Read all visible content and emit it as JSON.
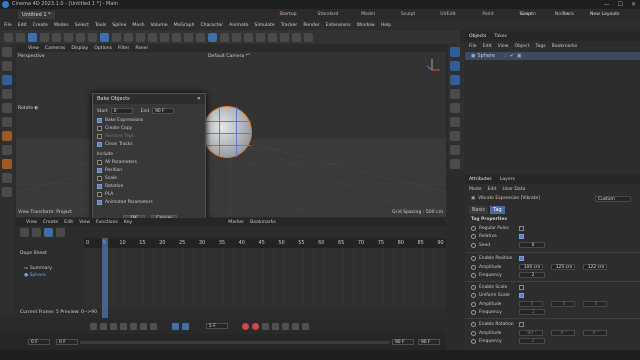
{
  "window": {
    "title": "Cinema 4D 2023.1.0 - [Untitled 1 *] - Main",
    "doc_tab": "Untitled 1 *",
    "controls": [
      "—",
      "☐",
      "✕"
    ]
  },
  "layout_tabs": [
    "Startup",
    "Standard",
    "Model",
    "Sculpt",
    "UVEdit",
    "Paint",
    "Groom",
    "Track",
    "Script",
    "Nodes"
  ],
  "new_layouts": "New Layouts",
  "menubar": [
    "File",
    "Edit",
    "Create",
    "Modes",
    "Select",
    "Tools",
    "Spline",
    "Mesh",
    "Volume",
    "MoGraph",
    "Character",
    "Animate",
    "Simulate",
    "Tracker",
    "Render",
    "Extensions",
    "Window",
    "Help"
  ],
  "viewport": {
    "menu": [
      "View",
      "Cameras",
      "Display",
      "Options",
      "Filter",
      "Panel"
    ],
    "name": "Perspective",
    "camera": "Default Camera *°",
    "rotate_label": "Rotate ◐",
    "transform_label": "View Transform: Project",
    "grid_label": "Grid Spacing : 500 cm"
  },
  "dialog": {
    "title": "Bake Objects",
    "start_label": "Start",
    "start_value": "0",
    "end_label": "End",
    "end_value": "90 F",
    "options": [
      {
        "label": "Bake Expressions",
        "checked": true,
        "dim": false
      },
      {
        "label": "Create Copy",
        "checked": false,
        "dim": false
      },
      {
        "label": "Remove Tags",
        "checked": false,
        "dim": true
      },
      {
        "label": "Clean Tracks",
        "checked": true,
        "dim": false
      }
    ],
    "include_label": "Include",
    "include": [
      {
        "label": "All Parameters",
        "checked": false
      },
      {
        "label": "Position",
        "checked": true
      },
      {
        "label": "Scale",
        "checked": false
      },
      {
        "label": "Rotation",
        "checked": true
      },
      {
        "label": "PLA",
        "checked": false
      },
      {
        "label": "Animated Parameters",
        "checked": true
      }
    ],
    "ok": "OK",
    "cancel": "Cancel"
  },
  "timeline": {
    "menu": [
      "View",
      "Create",
      "Edit",
      "View",
      "Functions",
      "Key",
      "Marker",
      "Bookmarks"
    ],
    "title": "Dope Sheet",
    "ruler": [
      "0",
      "5",
      "10",
      "15",
      "20",
      "25",
      "30",
      "35",
      "40",
      "45",
      "50",
      "55",
      "60",
      "65",
      "70",
      "75",
      "80",
      "85",
      "90"
    ],
    "items": [
      "Summary",
      "Sphere"
    ],
    "status": "Current Frame: 5  Preview: 0-->90"
  },
  "transport": {
    "current_frame": "5 F",
    "start": "0 F",
    "start2": "0 F",
    "end": "90 F",
    "end2": "90 F"
  },
  "objects_panel": {
    "tabs": [
      "Objects",
      "Takes"
    ],
    "menu": [
      "File",
      "Edit",
      "View",
      "Object",
      "Tags",
      "Bookmarks"
    ],
    "object": "Sphere"
  },
  "attributes_panel": {
    "tabs": [
      "Attributes",
      "Layers"
    ],
    "menu": [
      "Mode",
      "Edit",
      "User Data"
    ],
    "tag_title": "Vibrate Expression [Vibrate]",
    "preset": "Custom",
    "sub_tabs": [
      "Basic",
      "Tag"
    ],
    "section": "Tag Properties",
    "regular_pulse": "Regular Pulse",
    "relative": "Relative",
    "seed_label": "Seed",
    "seed_value": "0",
    "enable_position": "Enable Position",
    "amplitude_label": "Amplitude",
    "amp_x": "100 cm",
    "amp_y": "125 cm",
    "amp_z": "122 cm",
    "frequency_label": "Frequency",
    "freq_value": "2",
    "enable_scale": "Enable Scale",
    "uniform_scale": "Uniform Scale",
    "amplitude2_label": "Amplitude",
    "s_x": "0",
    "s_y": "0",
    "s_z": "0",
    "frequency2_label": "Frequency",
    "freq2_value": "2",
    "enable_rotation": "Enable Rotation",
    "amplitude3_label": "Amplitude",
    "r_x": "90 °",
    "r_y": "0 °",
    "r_z": "0 °",
    "frequency3_label": "Frequency",
    "freq3_value": "2"
  },
  "colors": {
    "accent_blue": "#5b7fc0",
    "selection_orange": "#e07a2a",
    "record_red": "#c94a4a"
  }
}
